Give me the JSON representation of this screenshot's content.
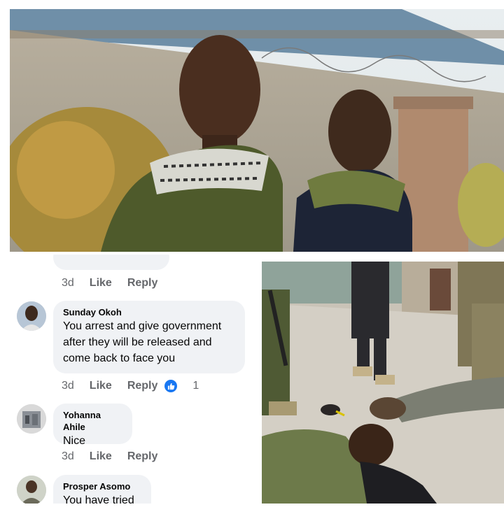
{
  "comments": [
    {
      "author": "",
      "text": "",
      "time": "3d",
      "like_label": "Like",
      "reply_label": "Reply",
      "reaction_count": "",
      "partial_top": true
    },
    {
      "author": "Sunday Okoh",
      "text_lines": [
        "You arrest and give government",
        "after they will be released and",
        "come back to face you"
      ],
      "time": "3d",
      "like_label": "Like",
      "reply_label": "Reply",
      "reaction_icon": "like-icon",
      "reaction_count": "1"
    },
    {
      "author": "Yohanna Ahile",
      "text": "Nice",
      "time": "3d",
      "like_label": "Like",
      "reply_label": "Reply"
    },
    {
      "author": "Prosper Asomo",
      "text": "You have tried"
    }
  ],
  "colors": {
    "bubble_bg": "#f0f2f5",
    "meta_text": "#65676b",
    "like_blue": "#1877f2"
  },
  "images": {
    "top_photo": "two-detained-men-photo",
    "bottom_photo": "arrest-scene-photo"
  }
}
